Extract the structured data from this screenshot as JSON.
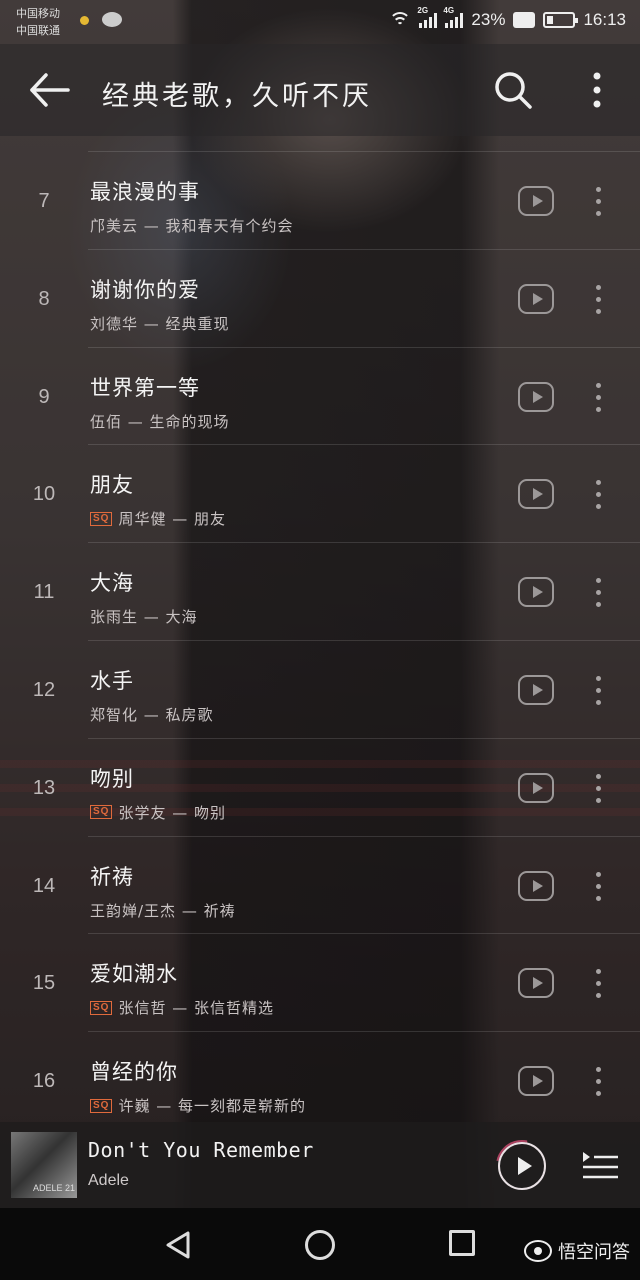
{
  "status_bar": {
    "carrier1": "中国移动",
    "carrier2": "中国联通",
    "net1": "2G",
    "net2": "4G",
    "battery": "23%",
    "time": "16:13"
  },
  "header": {
    "title": "经典老歌，久听不厌",
    "back_icon": "back-arrow-icon",
    "search_icon": "search-icon",
    "more_icon": "more-vertical-icon"
  },
  "songs": [
    {
      "num": "7",
      "name": "最浪漫的事",
      "sub": "邝美云 — 我和春天有个约会",
      "sq": false
    },
    {
      "num": "8",
      "name": "谢谢你的爱",
      "sub": "刘德华 — 经典重现",
      "sq": false
    },
    {
      "num": "9",
      "name": "世界第一等",
      "sub": "伍佰 — 生命的现场",
      "sq": false
    },
    {
      "num": "10",
      "name": "朋友",
      "sub": "周华健 — 朋友",
      "sq": true
    },
    {
      "num": "11",
      "name": "大海",
      "sub": "张雨生 — 大海",
      "sq": false
    },
    {
      "num": "12",
      "name": "水手",
      "sub": "郑智化 — 私房歌",
      "sq": false
    },
    {
      "num": "13",
      "name": "吻别",
      "sub": "张学友 — 吻别",
      "sq": true
    },
    {
      "num": "14",
      "name": "祈祷",
      "sub": "王韵婵/王杰 — 祈祷",
      "sq": false
    },
    {
      "num": "15",
      "name": "爱如潮水",
      "sub": "张信哲 — 张信哲精选",
      "sq": true
    },
    {
      "num": "16",
      "name": "曾经的你",
      "sub": "许巍 — 每一刻都是崭新的",
      "sq": true
    }
  ],
  "sq_label": "SQ",
  "player": {
    "song": "Don't You Remember",
    "artist": "Adele",
    "cover_label": "ADELE 21"
  },
  "watermark": "悟空问答",
  "colors": {
    "accent": "#e06a3c",
    "play_ring": "#dc5078"
  }
}
